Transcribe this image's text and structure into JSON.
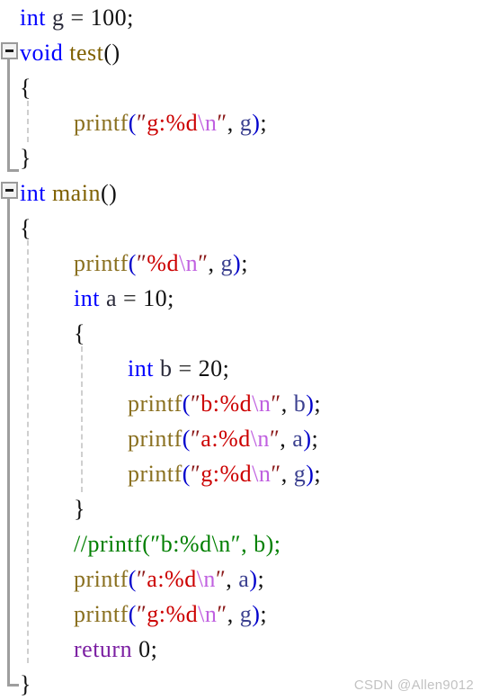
{
  "editor": {
    "language": "c",
    "background": "#ffffff",
    "watermark": "CSDN @Allen9012",
    "line_height": 39,
    "font_size": 26
  },
  "colors": {
    "keyword": "#0000ff",
    "return_keyword": "#7b1fa2",
    "function_name": "#7f6000",
    "function_call": "#8a7020",
    "string": "#cc0000",
    "string_quote": "#8b1a1a",
    "escape": "#c060e0",
    "comment": "#007f00",
    "number": "#111111",
    "paren": "#0000cc",
    "identifier": "#2a2a3a",
    "argument_identifier": "#3a3f8f",
    "fold_rail": "#9e9e9e",
    "indent_guide": "#cfcfcf",
    "watermark": "#c2c2c2"
  },
  "fold_markers": [
    {
      "name": "fold-marker-test",
      "line": 1,
      "state": "expanded",
      "glyph": "minus"
    },
    {
      "name": "fold-marker-main",
      "line": 5,
      "state": "expanded",
      "glyph": "minus"
    }
  ],
  "code": {
    "lines": [
      {
        "index": 0,
        "indent": 0,
        "tokens": [
          {
            "t": "int",
            "c": "kw"
          },
          {
            "t": " ",
            "c": "punct"
          },
          {
            "t": "g",
            "c": "id"
          },
          {
            "t": " ",
            "c": "punct"
          },
          {
            "t": "=",
            "c": "op"
          },
          {
            "t": " ",
            "c": "punct"
          },
          {
            "t": "100",
            "c": "num"
          },
          {
            "t": ";",
            "c": "punct"
          }
        ]
      },
      {
        "index": 1,
        "indent": 0,
        "tokens": [
          {
            "t": "void",
            "c": "kw"
          },
          {
            "t": " ",
            "c": "punct"
          },
          {
            "t": "test",
            "c": "fn"
          },
          {
            "t": "()",
            "c": "punct"
          }
        ]
      },
      {
        "index": 2,
        "indent": 0,
        "tokens": [
          {
            "t": "{",
            "c": "punct"
          }
        ]
      },
      {
        "index": 3,
        "indent": 1,
        "tokens": [
          {
            "t": "printf",
            "c": "call"
          },
          {
            "t": "(",
            "c": "paren"
          },
          {
            "t": "″",
            "c": "quote"
          },
          {
            "t": "g:%d",
            "c": "str"
          },
          {
            "t": "\\n",
            "c": "esc"
          },
          {
            "t": "″",
            "c": "quote"
          },
          {
            "t": ",",
            "c": "punct"
          },
          {
            "t": " ",
            "c": "punct"
          },
          {
            "t": "g",
            "c": "argid"
          },
          {
            "t": ")",
            "c": "paren"
          },
          {
            "t": ";",
            "c": "punct"
          }
        ]
      },
      {
        "index": 4,
        "indent": 0,
        "tokens": [
          {
            "t": "}",
            "c": "punct"
          }
        ]
      },
      {
        "index": 5,
        "indent": 0,
        "tokens": [
          {
            "t": "int",
            "c": "kw"
          },
          {
            "t": " ",
            "c": "punct"
          },
          {
            "t": "main",
            "c": "fn"
          },
          {
            "t": "()",
            "c": "punct"
          }
        ]
      },
      {
        "index": 6,
        "indent": 0,
        "tokens": [
          {
            "t": "{",
            "c": "punct"
          }
        ]
      },
      {
        "index": 7,
        "indent": 1,
        "tokens": [
          {
            "t": "printf",
            "c": "call"
          },
          {
            "t": "(",
            "c": "paren"
          },
          {
            "t": "″",
            "c": "quote"
          },
          {
            "t": "%d",
            "c": "str"
          },
          {
            "t": "\\n",
            "c": "esc"
          },
          {
            "t": "″",
            "c": "quote"
          },
          {
            "t": ",",
            "c": "punct"
          },
          {
            "t": " ",
            "c": "punct"
          },
          {
            "t": "g",
            "c": "argid"
          },
          {
            "t": ")",
            "c": "paren"
          },
          {
            "t": ";",
            "c": "punct"
          }
        ]
      },
      {
        "index": 8,
        "indent": 1,
        "tokens": [
          {
            "t": "int",
            "c": "kw"
          },
          {
            "t": " ",
            "c": "punct"
          },
          {
            "t": "a",
            "c": "id"
          },
          {
            "t": " ",
            "c": "punct"
          },
          {
            "t": "=",
            "c": "op"
          },
          {
            "t": " ",
            "c": "punct"
          },
          {
            "t": "10",
            "c": "num"
          },
          {
            "t": ";",
            "c": "punct"
          }
        ]
      },
      {
        "index": 9,
        "indent": 1,
        "tokens": [
          {
            "t": "{",
            "c": "punct"
          }
        ]
      },
      {
        "index": 10,
        "indent": 2,
        "tokens": [
          {
            "t": "int",
            "c": "kw"
          },
          {
            "t": " ",
            "c": "punct"
          },
          {
            "t": "b",
            "c": "id"
          },
          {
            "t": " ",
            "c": "punct"
          },
          {
            "t": "=",
            "c": "op"
          },
          {
            "t": " ",
            "c": "punct"
          },
          {
            "t": "20",
            "c": "num"
          },
          {
            "t": ";",
            "c": "punct"
          }
        ]
      },
      {
        "index": 11,
        "indent": 2,
        "tokens": [
          {
            "t": "printf",
            "c": "call"
          },
          {
            "t": "(",
            "c": "paren"
          },
          {
            "t": "″",
            "c": "quote"
          },
          {
            "t": "b:%d",
            "c": "str"
          },
          {
            "t": "\\n",
            "c": "esc"
          },
          {
            "t": "″",
            "c": "quote"
          },
          {
            "t": ",",
            "c": "punct"
          },
          {
            "t": " ",
            "c": "punct"
          },
          {
            "t": "b",
            "c": "argid"
          },
          {
            "t": ")",
            "c": "paren"
          },
          {
            "t": ";",
            "c": "punct"
          }
        ]
      },
      {
        "index": 12,
        "indent": 2,
        "tokens": [
          {
            "t": "printf",
            "c": "call"
          },
          {
            "t": "(",
            "c": "paren"
          },
          {
            "t": "″",
            "c": "quote"
          },
          {
            "t": "a:%d",
            "c": "str"
          },
          {
            "t": "\\n",
            "c": "esc"
          },
          {
            "t": "″",
            "c": "quote"
          },
          {
            "t": ",",
            "c": "punct"
          },
          {
            "t": " ",
            "c": "punct"
          },
          {
            "t": "a",
            "c": "argid"
          },
          {
            "t": ")",
            "c": "paren"
          },
          {
            "t": ";",
            "c": "punct"
          }
        ]
      },
      {
        "index": 13,
        "indent": 2,
        "tokens": [
          {
            "t": "printf",
            "c": "call"
          },
          {
            "t": "(",
            "c": "paren"
          },
          {
            "t": "″",
            "c": "quote"
          },
          {
            "t": "g:%d",
            "c": "str"
          },
          {
            "t": "\\n",
            "c": "esc"
          },
          {
            "t": "″",
            "c": "quote"
          },
          {
            "t": ",",
            "c": "punct"
          },
          {
            "t": " ",
            "c": "punct"
          },
          {
            "t": "g",
            "c": "argid"
          },
          {
            "t": ")",
            "c": "paren"
          },
          {
            "t": ";",
            "c": "punct"
          }
        ]
      },
      {
        "index": 14,
        "indent": 1,
        "tokens": [
          {
            "t": "}",
            "c": "punct"
          }
        ]
      },
      {
        "index": 15,
        "indent": 1,
        "tokens": [
          {
            "t": "//printf(″b:%d\\n″, b);",
            "c": "comment"
          }
        ]
      },
      {
        "index": 16,
        "indent": 1,
        "tokens": [
          {
            "t": "printf",
            "c": "call"
          },
          {
            "t": "(",
            "c": "paren"
          },
          {
            "t": "″",
            "c": "quote"
          },
          {
            "t": "a:%d",
            "c": "str"
          },
          {
            "t": "\\n",
            "c": "esc"
          },
          {
            "t": "″",
            "c": "quote"
          },
          {
            "t": ",",
            "c": "punct"
          },
          {
            "t": " ",
            "c": "punct"
          },
          {
            "t": "a",
            "c": "argid"
          },
          {
            "t": ")",
            "c": "paren"
          },
          {
            "t": ";",
            "c": "punct"
          }
        ]
      },
      {
        "index": 17,
        "indent": 1,
        "tokens": [
          {
            "t": "printf",
            "c": "call"
          },
          {
            "t": "(",
            "c": "paren"
          },
          {
            "t": "″",
            "c": "quote"
          },
          {
            "t": "g:%d",
            "c": "str"
          },
          {
            "t": "\\n",
            "c": "esc"
          },
          {
            "t": "″",
            "c": "quote"
          },
          {
            "t": ",",
            "c": "punct"
          },
          {
            "t": " ",
            "c": "punct"
          },
          {
            "t": "g",
            "c": "argid"
          },
          {
            "t": ")",
            "c": "paren"
          },
          {
            "t": ";",
            "c": "punct"
          }
        ]
      },
      {
        "index": 18,
        "indent": 1,
        "tokens": [
          {
            "t": "return",
            "c": "ret"
          },
          {
            "t": " ",
            "c": "punct"
          },
          {
            "t": "0",
            "c": "num"
          },
          {
            "t": ";",
            "c": "punct"
          }
        ]
      },
      {
        "index": 19,
        "indent": 0,
        "tokens": [
          {
            "t": "}",
            "c": "punct"
          }
        ]
      }
    ]
  }
}
